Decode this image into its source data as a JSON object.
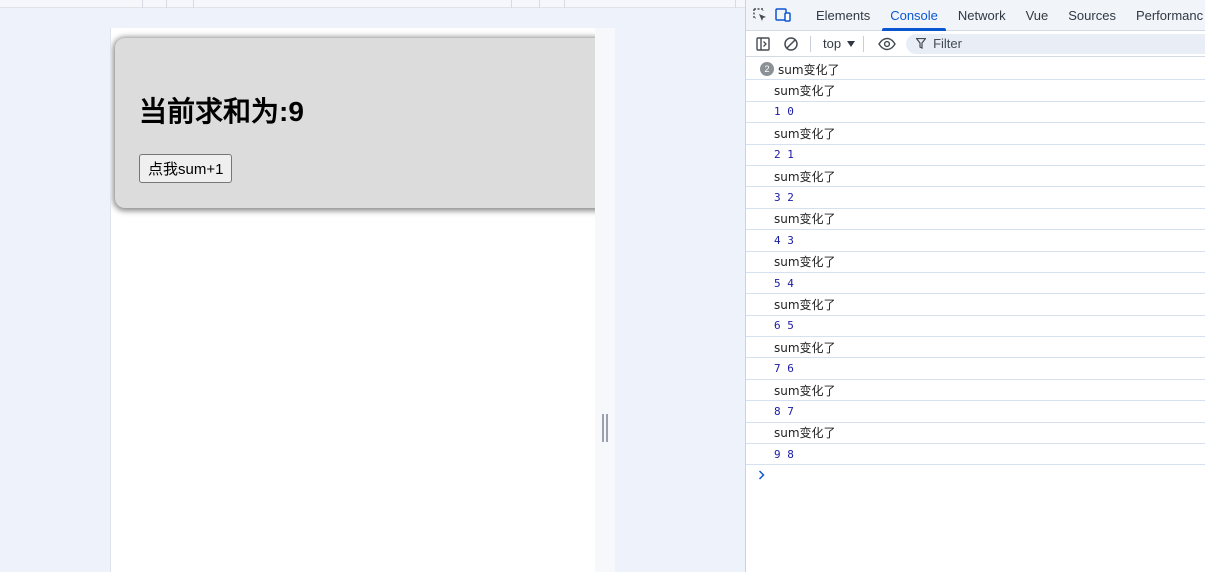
{
  "app": {
    "heading": "当前求和为:9",
    "button_label": "点我sum+1"
  },
  "devtools": {
    "tabs": [
      {
        "label": "Elements"
      },
      {
        "label": "Console"
      },
      {
        "label": "Network"
      },
      {
        "label": "Vue"
      },
      {
        "label": "Sources"
      },
      {
        "label": "Performanc"
      }
    ],
    "active_tab": "Console",
    "context": "top",
    "filter_placeholder": "Filter",
    "accent_color": "#0b57d0"
  },
  "console": {
    "group_count": "2",
    "group_message": "sum变化了",
    "entries": [
      "sum变化了",
      "1 0",
      "sum变化了",
      "2 1",
      "sum变化了",
      "3 2",
      "sum变化了",
      "4 3",
      "sum变化了",
      "5 4",
      "sum变化了",
      "6 5",
      "sum变化了",
      "7 6",
      "sum变化了",
      "8 7",
      "sum变化了",
      "9 8"
    ],
    "prompt_icon": "chevron-right-icon"
  }
}
